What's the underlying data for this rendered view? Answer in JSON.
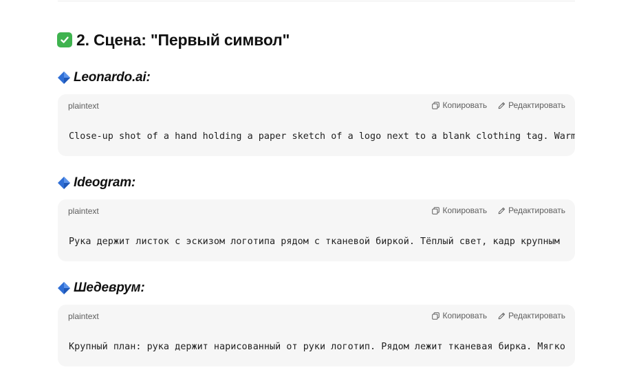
{
  "section": {
    "title": "2. Сцена: \"Первый символ\"",
    "title_icon": "check-mark-button-icon"
  },
  "blocks": [
    {
      "heading": "Leonardo.ai:",
      "heading_icon": "blue-diamond-icon",
      "language": "plaintext",
      "copy_label": "Копировать",
      "edit_label": "Редактировать",
      "code": "Close-up shot of a hand holding a paper sketch of a logo next to a blank clothing tag. Warm"
    },
    {
      "heading": "Ideogram:",
      "heading_icon": "blue-diamond-icon",
      "language": "plaintext",
      "copy_label": "Копировать",
      "edit_label": "Редактировать",
      "code": "Рука держит листок с эскизом логотипа рядом с тканевой биркой. Тёплый свет, кадр крупным"
    },
    {
      "heading": "Шедеврум:",
      "heading_icon": "blue-diamond-icon",
      "language": "plaintext",
      "copy_label": "Копировать",
      "edit_label": "Редактировать",
      "code": "Крупный план: рука держит нарисованный от руки логотип. Рядом лежит тканевая бирка. Мягко"
    }
  ],
  "colors": {
    "check_green": "#3fb34f",
    "diamond_blue": "#2f6fd6",
    "code_bg": "#f6f6f6",
    "muted_text": "#5d5d5d"
  }
}
